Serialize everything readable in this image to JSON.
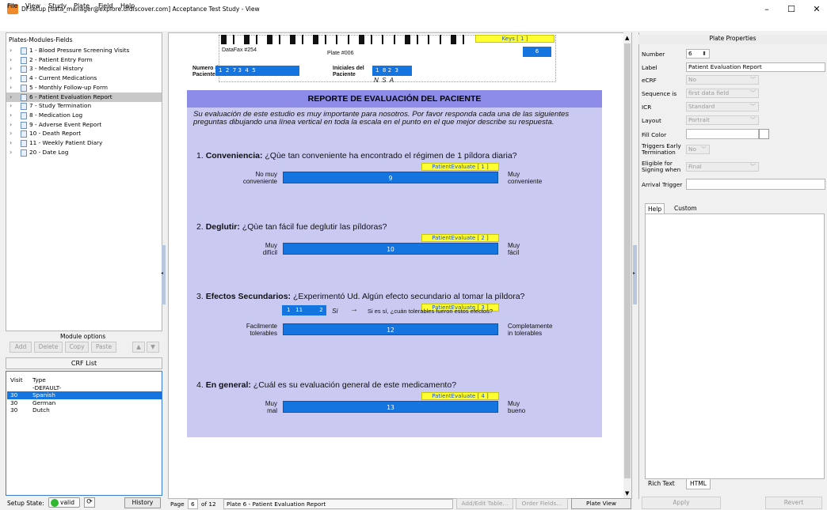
{
  "window": {
    "title": "DFsetup [data_manager@explore.dfdiscover.com] Acceptance Test Study - View",
    "minimize": "–",
    "maximize": "☐",
    "close": "✕"
  },
  "menu": [
    "File",
    "View",
    "Study",
    "Plate",
    "Field",
    "Help"
  ],
  "tree": {
    "title": "Plates-Modules-Fields",
    "items": [
      "1 - Blood Pressure Screening Visits",
      "2 - Patient Entry Form",
      "3 - Medical History",
      "4 - Current Medications",
      "5 - Monthly Follow-up Form",
      "6 - Patient Evaluation Report",
      "7 - Study Termination",
      "8 - Medication Log",
      "9 - Adverse Event Report",
      "10 - Death Report",
      "11 - Weekly Patient Diary",
      "20 - Date Log"
    ],
    "selected_index": 5
  },
  "module_options": {
    "label": "Module options",
    "add": "Add",
    "delete": "Delete",
    "copy": "Copy",
    "paste": "Paste"
  },
  "crf_list": {
    "title": "CRF List",
    "headers": [
      "Visit",
      "Type"
    ],
    "rows": [
      [
        "",
        "-DEFAULT-"
      ],
      [
        "30",
        "Spanish"
      ],
      [
        "30",
        "German"
      ],
      [
        "30",
        "Dutch"
      ]
    ],
    "selected_index": 1
  },
  "setup_state": {
    "label": "Setup State:",
    "status": "valid",
    "history": "History"
  },
  "plate": {
    "datafax": "DataFax #254",
    "plate_no": "Plate #006",
    "keys_tag": "Keys [ 1 ]",
    "keys_value": "6",
    "numero_label_1": "Numero de",
    "numero_label_2": "Paciente",
    "numero_digits": "1  2  7 3  4  5",
    "iniciales_label_1": "Iniciales del",
    "iniciales_label_2": "Paciente",
    "iniciales_digits": "1  8 2  3",
    "nsa": "N  S  A",
    "title": "REPORTE DE EVALUACIÓN DEL PACIENTE",
    "intro": "Su evaluación de este estudio es muy importante para nosotros. Por favor responda cada una de las siguientes preguntas dibujando una línea vertical en toda la escala en el punto en el que mejor describe su respuesta.",
    "questions": [
      {
        "num": "1.",
        "bold": "Conveniencia:",
        "text": "¿Qùe tan conveniente ha encontrado el régimen de 1 píldora diaria?",
        "tag": "PatientEvaluate [ 1 ]",
        "left_1": "No muy",
        "left_2": "conveniente",
        "value": "9",
        "right_1": "Muy",
        "right_2": "conveniente"
      },
      {
        "num": "2.",
        "bold": "Deglutir:",
        "text": "¿Qùe tan fácil fue deglutir las píldoras?",
        "tag": "PatientEvaluate [ 2 ]",
        "left_1": "Muy",
        "left_2": "difícil",
        "value": "10",
        "right_1": "Muy",
        "right_2": "fácil"
      },
      {
        "num": "3.",
        "bold": "Efectos Secundarios:",
        "text": "¿Experimentó Ud. Algún efecto secundario al tomar la píldora?",
        "tag": "PatientEvaluate [ 3 ]",
        "left_1": "Facilmente",
        "left_2": "tolerables",
        "value": "12",
        "right_1": "Completamente",
        "right_2": "in tolerables",
        "si_box": "1   11",
        "si_box_2": "2",
        "si": "Si",
        "arrow": "→",
        "followup": "Si es sí, ¿cuán tolerables fueron estos efectos?"
      },
      {
        "num": "4.",
        "bold": "En general:",
        "text": "¿Cuál es su evaluación general de este medicamento?",
        "tag": "PatientEvaluate [ 4 ]",
        "left_1": "Muy",
        "left_2": "mal",
        "value": "13",
        "right_1": "Muy",
        "right_2": "bueno"
      }
    ]
  },
  "status_bar": {
    "page_label": "Page",
    "page_num": "6",
    "page_of": "of 12",
    "plate_desc": "Plate 6 - Patient Evaluation Report",
    "add_edit_table": "Add/Edit Table...",
    "order_fields": "Order Fields...",
    "plate_view": "Plate View"
  },
  "properties": {
    "title": "Plate Properties",
    "number_label": "Number",
    "number_value": "6",
    "label_label": "Label",
    "label_value": "Patient Evaluation Report",
    "ecrf_label": "eCRF",
    "ecrf_value": "No",
    "sequence_label": "Sequence is",
    "sequence_value": "first data field",
    "icr_label": "ICR",
    "icr_value": "Standard",
    "layout_label": "Layout",
    "layout_value": "Portrait",
    "fill_label": "Fill Color",
    "triggers_label_1": "Triggers Early",
    "triggers_label_2": "Termination",
    "triggers_value": "No",
    "eligible_label_1": "Eligible for",
    "eligible_label_2": "Signing when",
    "eligible_value": "Final",
    "arrival_label": "Arrival Trigger",
    "tabs": [
      "Help",
      "Custom"
    ],
    "bottom_tabs": [
      "Rich Text",
      "HTML"
    ],
    "apply": "Apply",
    "revert": "Revert"
  }
}
